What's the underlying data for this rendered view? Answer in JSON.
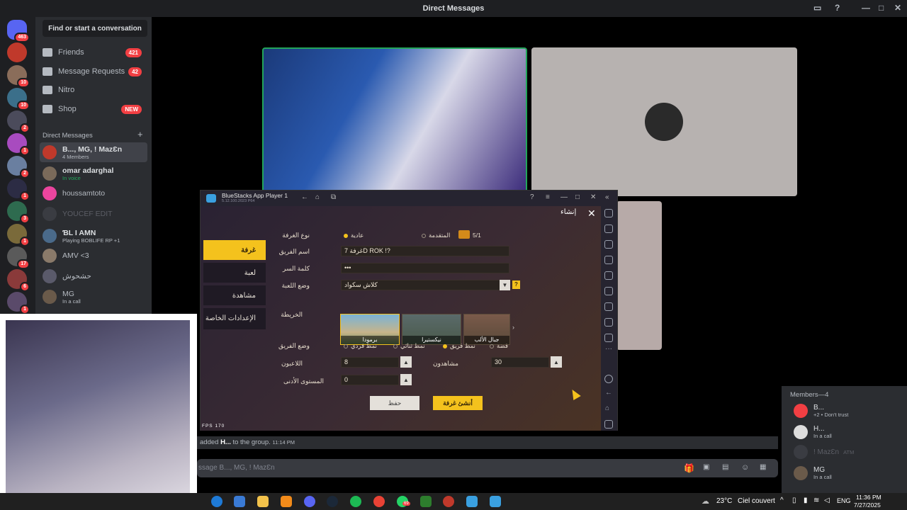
{
  "window": {
    "title": "Direct Messages"
  },
  "rail": {
    "home_badge": "463",
    "badges": [
      "10",
      "10",
      "2",
      "1",
      "2",
      "1",
      "3",
      "1",
      "17",
      "6",
      "1"
    ]
  },
  "sidebar": {
    "find_placeholder": "Find or start a conversation",
    "nav": [
      {
        "label": "Friends",
        "badge": "421"
      },
      {
        "label": "Message Requests",
        "badge": "42"
      },
      {
        "label": "Nitro",
        "badge": ""
      },
      {
        "label": "Shop",
        "badge": "NEW"
      }
    ],
    "dm_header": "Direct Messages",
    "dms": [
      {
        "name": "B..., MG, ! MazƐn",
        "sub": "4 Members"
      },
      {
        "name": "omar adarghal",
        "sub": "In voice"
      },
      {
        "name": "houssamtoto",
        "sub": ""
      },
      {
        "name": "YOUCEF EDIT",
        "sub": ""
      },
      {
        "name": "ƁL I AMN",
        "sub": "Playing BOBLIFE RP +1"
      },
      {
        "name": "AMV <3",
        "sub": ""
      },
      {
        "name": "حشحوش",
        "sub": ""
      },
      {
        "name": "MG",
        "sub": "In a call"
      }
    ]
  },
  "chat": {
    "system_msg_prefix": "added",
    "system_msg_user": "H...",
    "system_msg_suffix": "to the group.",
    "system_msg_time": "11:14 PM",
    "input_placeholder": "ssage B..., MG, ! MazƐn"
  },
  "members": {
    "header": "Members—4",
    "list": [
      {
        "name": "B...",
        "status": "+2 • Don't trust"
      },
      {
        "name": "H...",
        "status": "In a call"
      },
      {
        "name": "! MazƐn",
        "status": "ATM"
      },
      {
        "name": "MG",
        "status": "In a call"
      }
    ]
  },
  "bluestacks": {
    "title": "BlueStacks App Player 1",
    "subtitle": "5.12.100.2023 P64",
    "create_title": "إنشاء",
    "fps": "FPS 170",
    "tabs": [
      "غرفة",
      "لعبة",
      "مشاهدة",
      "الإعدادات الخاصة"
    ],
    "room_type_label": "نوع الغرفة",
    "room_type_options": [
      "عادية",
      "المتقدمة"
    ],
    "room_count": "5/1",
    "team_name_label": "اسم الفريق",
    "team_name_value": "غرفة 7D  ROK  !?",
    "password_label": "كلمة السر",
    "password_value": "•••",
    "game_mode_label": "وضع اللعبة",
    "game_mode_value": "كلاش سكواد",
    "map_label": "الخريطة",
    "maps": [
      "برمودا",
      "نيكستيرا",
      "جبال الألب"
    ],
    "team_mode_label": "وضع الفريق",
    "team_mode_options": [
      "نمط فردي",
      "نمط ثنائي",
      "نمط فريق",
      "فضة"
    ],
    "players_label": "اللاعبون",
    "players_value": "8",
    "spectators_label": "مشاهدون",
    "spectators_value": "30",
    "min_level_label": "المستوى الأدنى",
    "min_level_value": "0",
    "save_button": "حفظ",
    "create_button": "أنشئ غرفة"
  },
  "taskbar": {
    "weather_temp": "23°C",
    "weather_text": "Ciel couvert",
    "lang": "ENG",
    "time": "11:36 PM",
    "date": "7/27/2025",
    "whatsapp_badge": "69"
  },
  "colors": {
    "accent": "#f4c21d",
    "discord_red": "#f23f43",
    "bg_dark": "#1e1f22"
  }
}
